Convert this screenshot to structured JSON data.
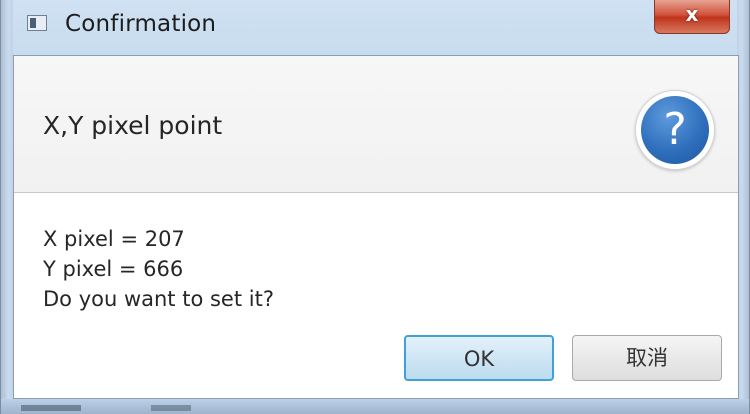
{
  "window": {
    "title": "Confirmation",
    "close_label": "x"
  },
  "dialog": {
    "header": "X,Y pixel point",
    "icon": "question-mark-icon",
    "icon_glyph": "?",
    "lines": [
      "X pixel = 207",
      "Y pixel = 666",
      "Do you want to set it?"
    ],
    "buttons": {
      "ok": "OK",
      "cancel": "取消"
    }
  },
  "colors": {
    "titlebar": "#c6daec",
    "help_icon": "#2f6fbd",
    "ok_border": "#3fa1d8",
    "close_button": "#c0341d"
  }
}
